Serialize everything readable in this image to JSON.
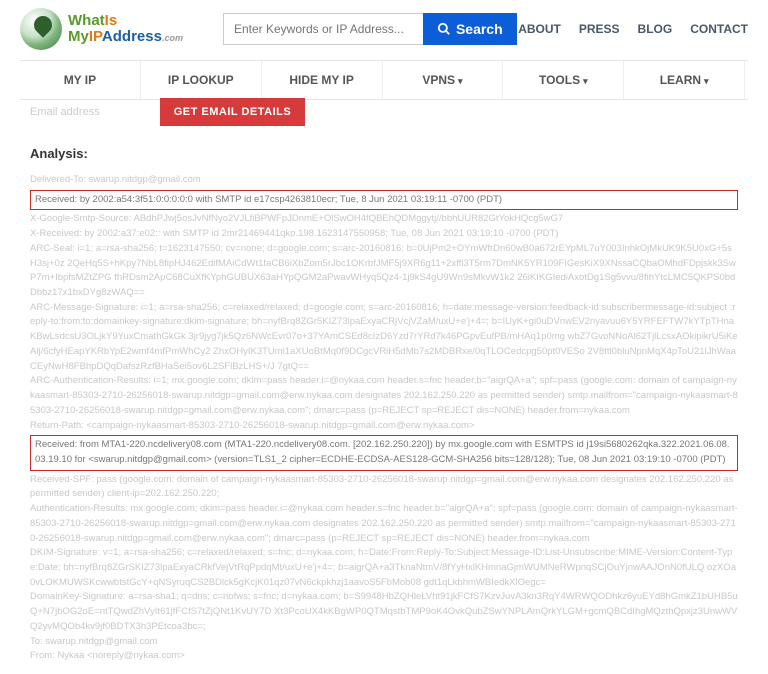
{
  "header": {
    "logo": {
      "w1": "What",
      "w2": "Is",
      "w3": "My",
      "w4": "IP",
      "w5": "Address",
      "sub": ".com"
    },
    "search": {
      "placeholder": "Enter Keywords or IP Address...",
      "button": "Search"
    },
    "nav": {
      "about": "ABOUT",
      "press": "PRESS",
      "blog": "BLOG",
      "contact": "CONTACT"
    }
  },
  "mainnav": {
    "myip": "MY IP",
    "iplookup": "IP LOOKUP",
    "hidemyip": "HIDE MY IP",
    "vpns": "VPNS",
    "tools": "TOOLS",
    "learn": "LEARN"
  },
  "subbar": {
    "label": "Email address",
    "button": "GET EMAIL DETAILS"
  },
  "analysis": {
    "title": "Analysis:",
    "l1": "Delivered-To: swarup.nitdgp@gmail.com",
    "box1": "Received: by 2002:a54:3f51:0:0:0:0:0 with SMTP id e17csp4263810ecr; Tue, 8 Jun 2021 03:19:11 -0700 (PDT)",
    "l2": "X-Google-Smtp-Source: ABdhPJwj5osJvNfNyo2VJLfiBPWFpJDnmE+OlSwOH4fQBEhQDMggytj//bbhUUR82GtYokHQcg5wG7",
    "l3": "X-Received: by 2002:a37:e02:: with SMTP id 2mr21469441qko.198.1623147550958; Tue, 08 Jun 2021 03:19:10 -0700 (PDT)",
    "l4": "ARC-Seal: i=1; a=rsa-sha256; t=1623147550; cv=none; d=google.com; s=arc-20160816; b=0UjPm2+OYmWfrDn60wB0a672rEYpML7uY003InhkOjMkUK9K5U0xG+5sH3sj+0z 2QeHq5S+hKpy7NbL8fipHJ462EdifMAiCdWt1faCB6iXbZom5rJbc1OKrbfJMF5j9XR6g11+2xffl3T5rm7DmNK5YR109FIGesKiX9XNssaCQbaOMhdFDpjskk3SwP7m+IbpfsMZtZPG fhRDsm2ApC68CuXfKYphGUBUX63aHYpQGM2aPwavWHyq5Qz4-1j9kS4gU9Wn9sMkvW1k2 26iKIKGIediAxotDg1Sg5vvu/8fihYtcLMC5QKPS0bdDbbz17x1bxDYg8zWAQ==",
    "l5": "ARC-Message-Signature: i=1; a=rsa-sha256; c=relaxed/relaxed; d=google.com; s=arc-20160816; h=date:message-version:feedback-id:subscribermessage-id:subject :reply-to:from:to:domainkey-signature:dkim-signature; bh=nyfBrq8ZGr5KIZ73lpaExyaCRjVcjVZaM/uxU+e'j+4=; b=IUyK+gi0uDVnwEV2nyavuu6Y5YRFEFTW7kYTpTHnaKBwLsdcsU3OLjkY9YuxCmathGkGk 3jr9jyg7jk5Qz6NWcEvr07o+37YAmCSEd8cIzD6Yzd7rYRd7k46PGpvEufPB/mHAq1p0mg wbZ7GvoNNoAl62TjlLcsxAOkipikrU5iKeAlj/6cfyHEapYKRbYpE2wmf4mfPmWhCy2 ZhxOHyIK3TUmi1aXUoBtMq0f9DCgcVRiH5dMb7s2MDBRxe/0qTLOCedcpg50pt0VESo 2V8ttl0bluNpnMqX4pToU21lJhWaaCEyNwH8FBhpDQqDafszRzfBHaSei5ov6L2SFlBzLHS+/J 7gtQ==",
    "l6": "ARC-Authentication-Results: i=1; mx.google.com; dkim=pass header.i=@nykaa.com header.s=fnc header.b=\"aigrQA+a\"; spf=pass (google.com: domain of campaign-nykaasmart-85303-2710-26256018-swarup.nitdgp=gmail.com@erw.nykaa.com designates 202.162.250.220 as permitted sender) smtp.mailfrom=\"campaign-nykaasmart-85303-2710-26256018-swarup.nitdgp=gmail.com@erw.nykaa.com\"; dmarc=pass (p=REJECT sp=REJECT dis=NONE) header.from=nykaa.com",
    "l7": "Return-Path: <campaign-nykaasmart-85303-2710-26256018-swarup.nitdgp=gmail.com@erw.nykaa.com>",
    "box2": "Received: from MTA1-220.ncdelivery08.com (MTA1-220.ncdelivery08.com. [202.162.250.220]) by mx.google.com with ESMTPS id j19si5680262qka.322.2021.06.08.03.19.10 for <swarup.nitdgp@gmail.com> (version=TLS1_2 cipher=ECDHE-ECDSA-AES128-GCM-SHA256 bits=128/128); Tue, 08 Jun 2021 03:19:10 -0700 (PDT)",
    "l8": "Received-SPF: pass (google.com: domain of campaign-nykaasmart-85303-2710-26256018-swarup.nitdgp=gmail.com@erw.nykaa.com designates 202.162.250.220 as permitted sender) client-ip=202.162.250.220;",
    "l9": "Authentication-Results: mx.google.com; dkim=pass header.i=@nykaa.com header.s=fnc header.b=\"aigrQA+a\"; spf=pass (google.com: domain of campaign-nykaasmart-85303-2710-26256018-swarup.nitdgp=gmail.com@erw.nykaa.com designates 202.162.250.220 as permitted sender) smtp.mailfrom=\"campaign-nykaasmart-85303-2710-26256018-swarup.nitdgp=gmail.com@erw.nykaa.com\"; dmarc=pass (p=REJECT sp=REJECT dis=NONE) header.from=nykaa.com",
    "l10": "DKIM-Signature: v=1; a=rsa-sha256; c=relaxed/relaxed; s=fnc; d=nykaa.com; h=Date:From:Reply-To:Subject:Message-ID:List-Unsubscribe:MIME-Version:Content-Type:Date; bh=nyfBrq8ZGrSKIZ73lpaExyaCRkfVejVtRqPpdqMt/uxU+e'j+4=; b=aigrQA+a3TknaNtmV/8fYyHxlKHmnaGjmWUMNeRWpnqSCjOuYjnwAAJOnN0fULQ ozXOa0vLOKMUWSKcwwbtstGcY+qNSyruqCS2BDlck5gKcjK01qz07vN6ckpkhzj1aavoS5FbMob08 gdt1qLkbhmWBIedkXlOegc=",
    "l11": "DomainKey-Signature: a=rsa-sha1; q=dns; c=nofws; s=fnc; d=nykaa.com; b=S9948HbZQHleLVht91jkFCfS7KzvJuvA3kn3RqY4WRWQODhkz6yuEYd8hGmkZ1bUHB5uQ+N7jbOG2oE=ntTQwdZhVyIt61jfFCfS7tZjQNt1KvUY7D Xt3PcoUX4kKBgWP0QTMqstbTMP9oK4OvkQubZSwYNPLAmQrkYLGM+gcmQBCdIhgMQzthQpxjz3UnwWVQ2yvMQOb4kv9jf0BDTX3h3PEtcoa3bc=;",
    "l12": "To: swarup.nitdgp@gmail.com",
    "l13": "From: Nykaa <noreply@nykaa.com>"
  }
}
